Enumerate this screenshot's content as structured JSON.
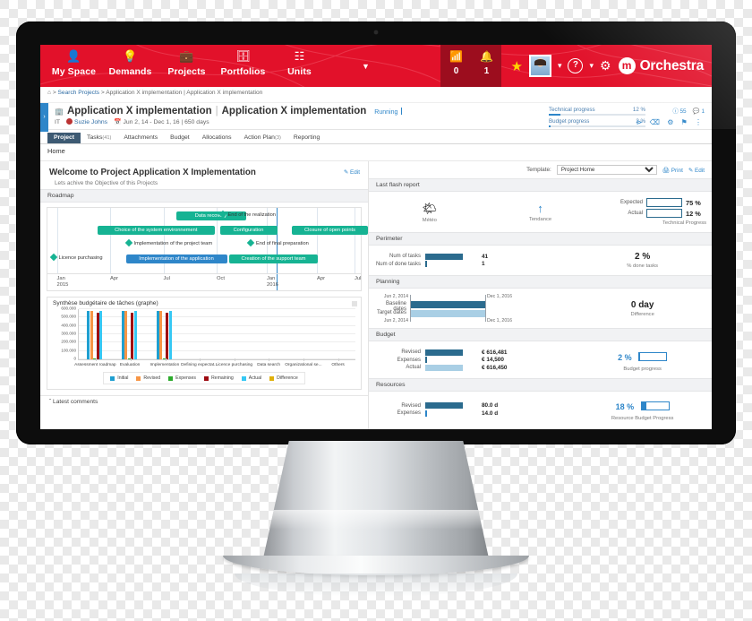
{
  "nav": {
    "items": [
      {
        "label": "My Space",
        "icon": "user-icon"
      },
      {
        "label": "Demands",
        "icon": "lightbulb-icon"
      },
      {
        "label": "Projects",
        "icon": "briefcase-icon"
      },
      {
        "label": "Portfolios",
        "icon": "portfolio-icon"
      },
      {
        "label": "Units",
        "icon": "org-tree-icon"
      }
    ],
    "counters": [
      {
        "icon": "rss-icon",
        "value": "0"
      },
      {
        "icon": "bell-icon",
        "value": "1"
      }
    ],
    "brand_mark": "m",
    "brand_name": "Orchestra"
  },
  "breadcrumb": {
    "home": "⌂",
    "sep": ">",
    "link": "Search Projects",
    "current": "Application X implementation | Application X implementation"
  },
  "project": {
    "name_left": "Application X implementation",
    "name_right": "Application X implementation",
    "status": "Running",
    "unit": "IT",
    "owner": "Suzie Johns",
    "dates": "Jun 2, 14 - Dec 1, 16 | 650 days",
    "kpis": [
      {
        "label": "Technical progress",
        "value": "12 %",
        "pct": 12
      },
      {
        "label": "Budget progress",
        "value": "2 %",
        "pct": 2
      }
    ],
    "counts": {
      "info": "55",
      "comments": "1"
    }
  },
  "tabs": [
    {
      "label": "Project",
      "count": "",
      "active": true
    },
    {
      "label": "Tasks",
      "count": "(41)",
      "active": false
    },
    {
      "label": "Attachments",
      "count": "",
      "active": false
    },
    {
      "label": "Budget",
      "count": "",
      "active": false
    },
    {
      "label": "Allocations",
      "count": "",
      "active": false
    },
    {
      "label": "Action Plan",
      "count": "(3)",
      "active": false
    },
    {
      "label": "Reporting",
      "count": "",
      "active": false
    }
  ],
  "subnav": {
    "label": "Home"
  },
  "template_row": {
    "label": "Template:",
    "selected": "Project Home",
    "options": [
      "Project Home"
    ],
    "print": "Print",
    "edit": "Edit"
  },
  "welcome": {
    "title": "Welcome to Project Application X Implementation",
    "subtitle": "Lets achive the Objective of this Projects",
    "edit": "Edit"
  },
  "roadmap": {
    "section_title": "Roadmap",
    "bars": [
      {
        "label": "Data recovery",
        "color": "green",
        "left": 41,
        "top": 4,
        "width": 20
      },
      {
        "label": "Choice of the system environnement",
        "color": "green",
        "left": 16,
        "top": 20,
        "width": 35
      },
      {
        "label": "Configuration",
        "color": "green",
        "left": 55,
        "top": 20,
        "width": 16
      },
      {
        "label": "Closure of open points",
        "color": "green",
        "left": 78,
        "top": 20,
        "width": 22
      },
      {
        "label": "Implementation of the application",
        "color": "blue",
        "left": 25,
        "top": 52,
        "width": 30
      },
      {
        "label": "Creation of the support team",
        "color": "green",
        "left": 58,
        "top": 52,
        "width": 26
      }
    ],
    "milestones": [
      {
        "label": "End of the realization",
        "left": 55,
        "top": 4
      },
      {
        "label": "Implementation of the project team",
        "left": 25,
        "top": 36
      },
      {
        "label": "End of final preparation",
        "left": 64,
        "top": 36
      },
      {
        "label": "Licence purchasing",
        "left": 1,
        "top": 52
      }
    ],
    "axis": [
      {
        "label": "Jan",
        "year": "2015",
        "left": 3
      },
      {
        "label": "Apr",
        "year": "",
        "left": 20
      },
      {
        "label": "Jul",
        "year": "",
        "left": 37
      },
      {
        "label": "Oct",
        "year": "",
        "left": 54
      },
      {
        "label": "Jan",
        "year": "2016",
        "left": 70
      },
      {
        "label": "Apr",
        "year": "",
        "left": 86
      },
      {
        "label": "Jul",
        "year": "",
        "left": 98
      }
    ],
    "today_left": 73
  },
  "chart_data": {
    "type": "bar",
    "title": "Synthèse budgétaire de tâches (graphe)",
    "xlabel": "",
    "ylabel": "",
    "ylim": [
      0,
      600000
    ],
    "yticks": [
      "0",
      "100.000",
      "200.000",
      "300.000",
      "400.000",
      "500.000",
      "600.000"
    ],
    "grid": true,
    "legend_position": "bottom",
    "categories": [
      "Assessment roadmap",
      "Evaluation",
      "Implementation",
      "Defining expectat...",
      "Licence purchasing",
      "Data search",
      "Organizational se...",
      "Others"
    ],
    "series": [
      {
        "name": "Initial",
        "color": "#1f9fd0",
        "values": [
          575000,
          575000,
          575000,
          0,
          0,
          0,
          0,
          0
        ]
      },
      {
        "name": "Revised",
        "color": "#f79646",
        "values": [
          575000,
          575000,
          575000,
          0,
          0,
          0,
          0,
          0
        ]
      },
      {
        "name": "Expenses",
        "color": "#2cab2c",
        "values": [
          14000,
          14000,
          14000,
          0,
          0,
          0,
          0,
          0
        ]
      },
      {
        "name": "Remaining",
        "color": "#9e0b12",
        "values": [
          560000,
          560000,
          560000,
          0,
          0,
          0,
          0,
          0
        ]
      },
      {
        "name": "Actual",
        "color": "#36c8f4",
        "values": [
          575000,
          575000,
          575000,
          0,
          0,
          0,
          0,
          0
        ]
      },
      {
        "name": "Difference",
        "color": "#e0b10b",
        "values": [
          0,
          0,
          0,
          0,
          0,
          0,
          0,
          0
        ]
      }
    ]
  },
  "latest_comments": {
    "label": "Latest comments",
    "chevron": "ˇ"
  },
  "flash": {
    "section_title": "Last flash report",
    "weather_label": "Météo",
    "weather_icon": "sun-cloud-icon",
    "trend_label": "Tendance",
    "trend_icon": "arrow-up-icon",
    "expected_label": "Expected",
    "expected_value": "75 %",
    "expected_pct": 75,
    "actual_label": "Actual",
    "actual_value": "12 %",
    "actual_pct": 12,
    "caption": "Technical Progress"
  },
  "perimeter": {
    "section_title": "Perimeter",
    "rows": [
      {
        "label": "Num of tasks",
        "value": "41",
        "bar": 100
      },
      {
        "label": "Num of done tasks",
        "value": "1",
        "bar": 3
      }
    ],
    "kpi_value": "2 %",
    "kpi_caption": "% done tasks"
  },
  "planning": {
    "section_title": "Planning",
    "rows": [
      {
        "label": "Baseline dates",
        "start": "Jun 2, 2014",
        "end": "Dec 1, 2016",
        "tone": "dark"
      },
      {
        "label": "Target dates",
        "start": "Jun 2, 2014",
        "end": "Dec 1, 2016",
        "tone": "light"
      }
    ],
    "kpi_value": "0 day",
    "kpi_caption": "Difference"
  },
  "budget": {
    "section_title": "Budget",
    "rows": [
      {
        "label": "Revised",
        "value": "€ 616,481",
        "bar": 100,
        "tone": "dark"
      },
      {
        "label": "Expenses",
        "value": "€ 14,500",
        "bar": 2,
        "tone": "dark"
      },
      {
        "label": "Actual",
        "value": "€ 616,450",
        "bar": 100,
        "tone": "light"
      }
    ],
    "kpi_value": "2 %",
    "kpi_pct": 2,
    "kpi_caption": "Budget progress"
  },
  "resources": {
    "section_title": "Resources",
    "rows": [
      {
        "label": "Revised",
        "value": "80.0 d",
        "bar": 100,
        "tone": "dark"
      },
      {
        "label": "Expenses",
        "value": "14.0 d",
        "bar": 4,
        "tone": "light"
      }
    ],
    "kpi_value": "18 %",
    "kpi_pct": 18,
    "kpi_caption": "Resource Budget Progress"
  }
}
